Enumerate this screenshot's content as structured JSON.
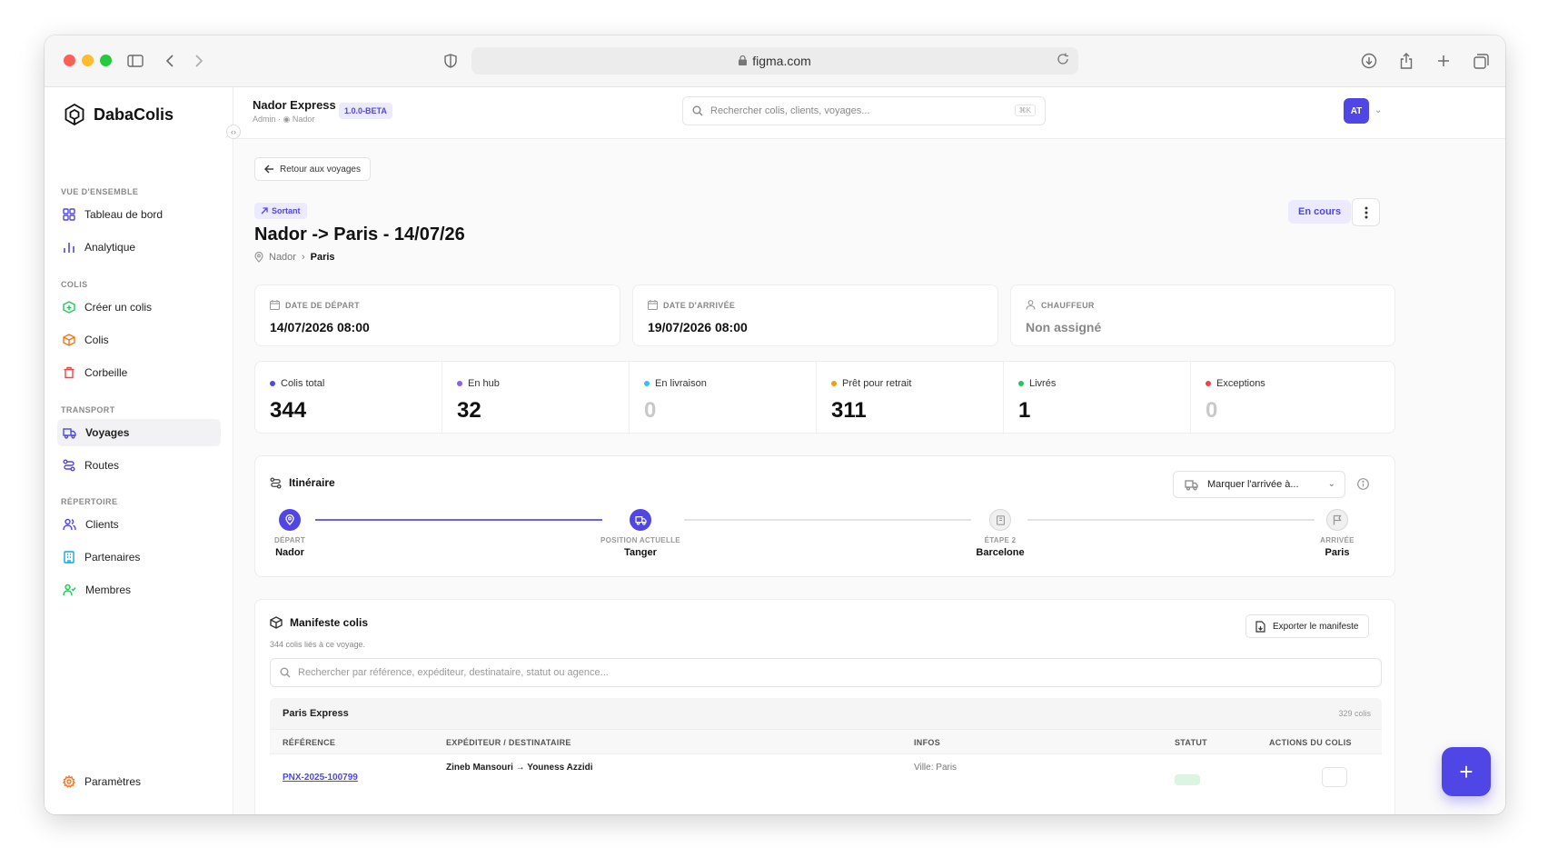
{
  "browser": {
    "url": "figma.com"
  },
  "sidebar": {
    "app_name": "DabaColis",
    "sections": [
      {
        "label": "VUE D'ENSEMBLE",
        "items": [
          {
            "label": "Tableau de bord",
            "icon": "dashboard-icon"
          },
          {
            "label": "Analytique",
            "icon": "bar-chart-icon"
          }
        ]
      },
      {
        "label": "COLIS",
        "items": [
          {
            "label": "Créer un colis",
            "icon": "package-plus-icon"
          },
          {
            "label": "Colis",
            "icon": "package-icon"
          },
          {
            "label": "Corbeille",
            "icon": "trash-icon"
          }
        ]
      },
      {
        "label": "TRANSPORT",
        "items": [
          {
            "label": "Voyages",
            "icon": "truck-icon",
            "active": true
          },
          {
            "label": "Routes",
            "icon": "route-icon"
          }
        ]
      },
      {
        "label": "RÉPERTOIRE",
        "items": [
          {
            "label": "Clients",
            "icon": "users-icon"
          },
          {
            "label": "Partenaires",
            "icon": "building-icon"
          },
          {
            "label": "Membres",
            "icon": "user-check-icon"
          }
        ]
      }
    ],
    "settings_label": "Paramètres"
  },
  "header": {
    "org_name": "Nador Express",
    "org_role": "Admin",
    "org_location": "Nador",
    "version": "1.0.0-BETA",
    "search_placeholder": "Rechercher colis, clients, voyages...",
    "search_shortcut": "⌘K",
    "avatar_initials": "AT"
  },
  "trip": {
    "back_label": "Retour aux voyages",
    "direction": "Sortant",
    "title": "Nador -> Paris - 14/07/26",
    "origin": "Nador",
    "destination": "Paris",
    "status": "En cours",
    "departure": {
      "label": "DATE DE DÉPART",
      "value": "14/07/2026 08:00"
    },
    "arrival": {
      "label": "DATE D'ARRIVÉE",
      "value": "19/07/2026 08:00"
    },
    "driver": {
      "label": "CHAUFFEUR",
      "value": "Non assigné"
    }
  },
  "stats": [
    {
      "label": "Colis total",
      "value": "344",
      "color": "#4f46e5"
    },
    {
      "label": "En hub",
      "value": "32",
      "color": "#8b5cf6"
    },
    {
      "label": "En livraison",
      "value": "0",
      "color": "#38bdf8"
    },
    {
      "label": "Prêt pour retrait",
      "value": "311",
      "color": "#f59e0b"
    },
    {
      "label": "Livrés",
      "value": "1",
      "color": "#22c55e"
    },
    {
      "label": "Exceptions",
      "value": "0",
      "color": "#ef4444"
    }
  ],
  "itinerary": {
    "title": "Itinéraire",
    "mark_arrival_label": "Marquer l'arrivée à...",
    "steps": [
      {
        "label": "DÉPART",
        "city": "Nador",
        "state": "done"
      },
      {
        "label": "POSITION ACTUELLE",
        "city": "Tanger",
        "state": "done"
      },
      {
        "label": "ÉTAPE 2",
        "city": "Barcelone",
        "state": "pending"
      },
      {
        "label": "ARRIVÉE",
        "city": "Paris",
        "state": "pending"
      }
    ]
  },
  "manifest": {
    "title": "Manifeste colis",
    "subtitle": "344 colis liés à ce voyage.",
    "export_label": "Exporter le manifeste",
    "search_placeholder": "Rechercher par référence, expéditeur, destinataire, statut ou agence...",
    "group": {
      "name": "Paris Express",
      "count": "329 colis"
    },
    "columns": [
      "RÉFÉRENCE",
      "EXPÉDITEUR / DESTINATAIRE",
      "INFOS",
      "STATUT",
      "ACTIONS DU COLIS"
    ],
    "rows": [
      {
        "reference": "PNX-2025-100799",
        "parties": "Zineb Mansouri → Youness Azzidi",
        "info": "Ville: Paris"
      }
    ]
  },
  "fab_label": "+"
}
